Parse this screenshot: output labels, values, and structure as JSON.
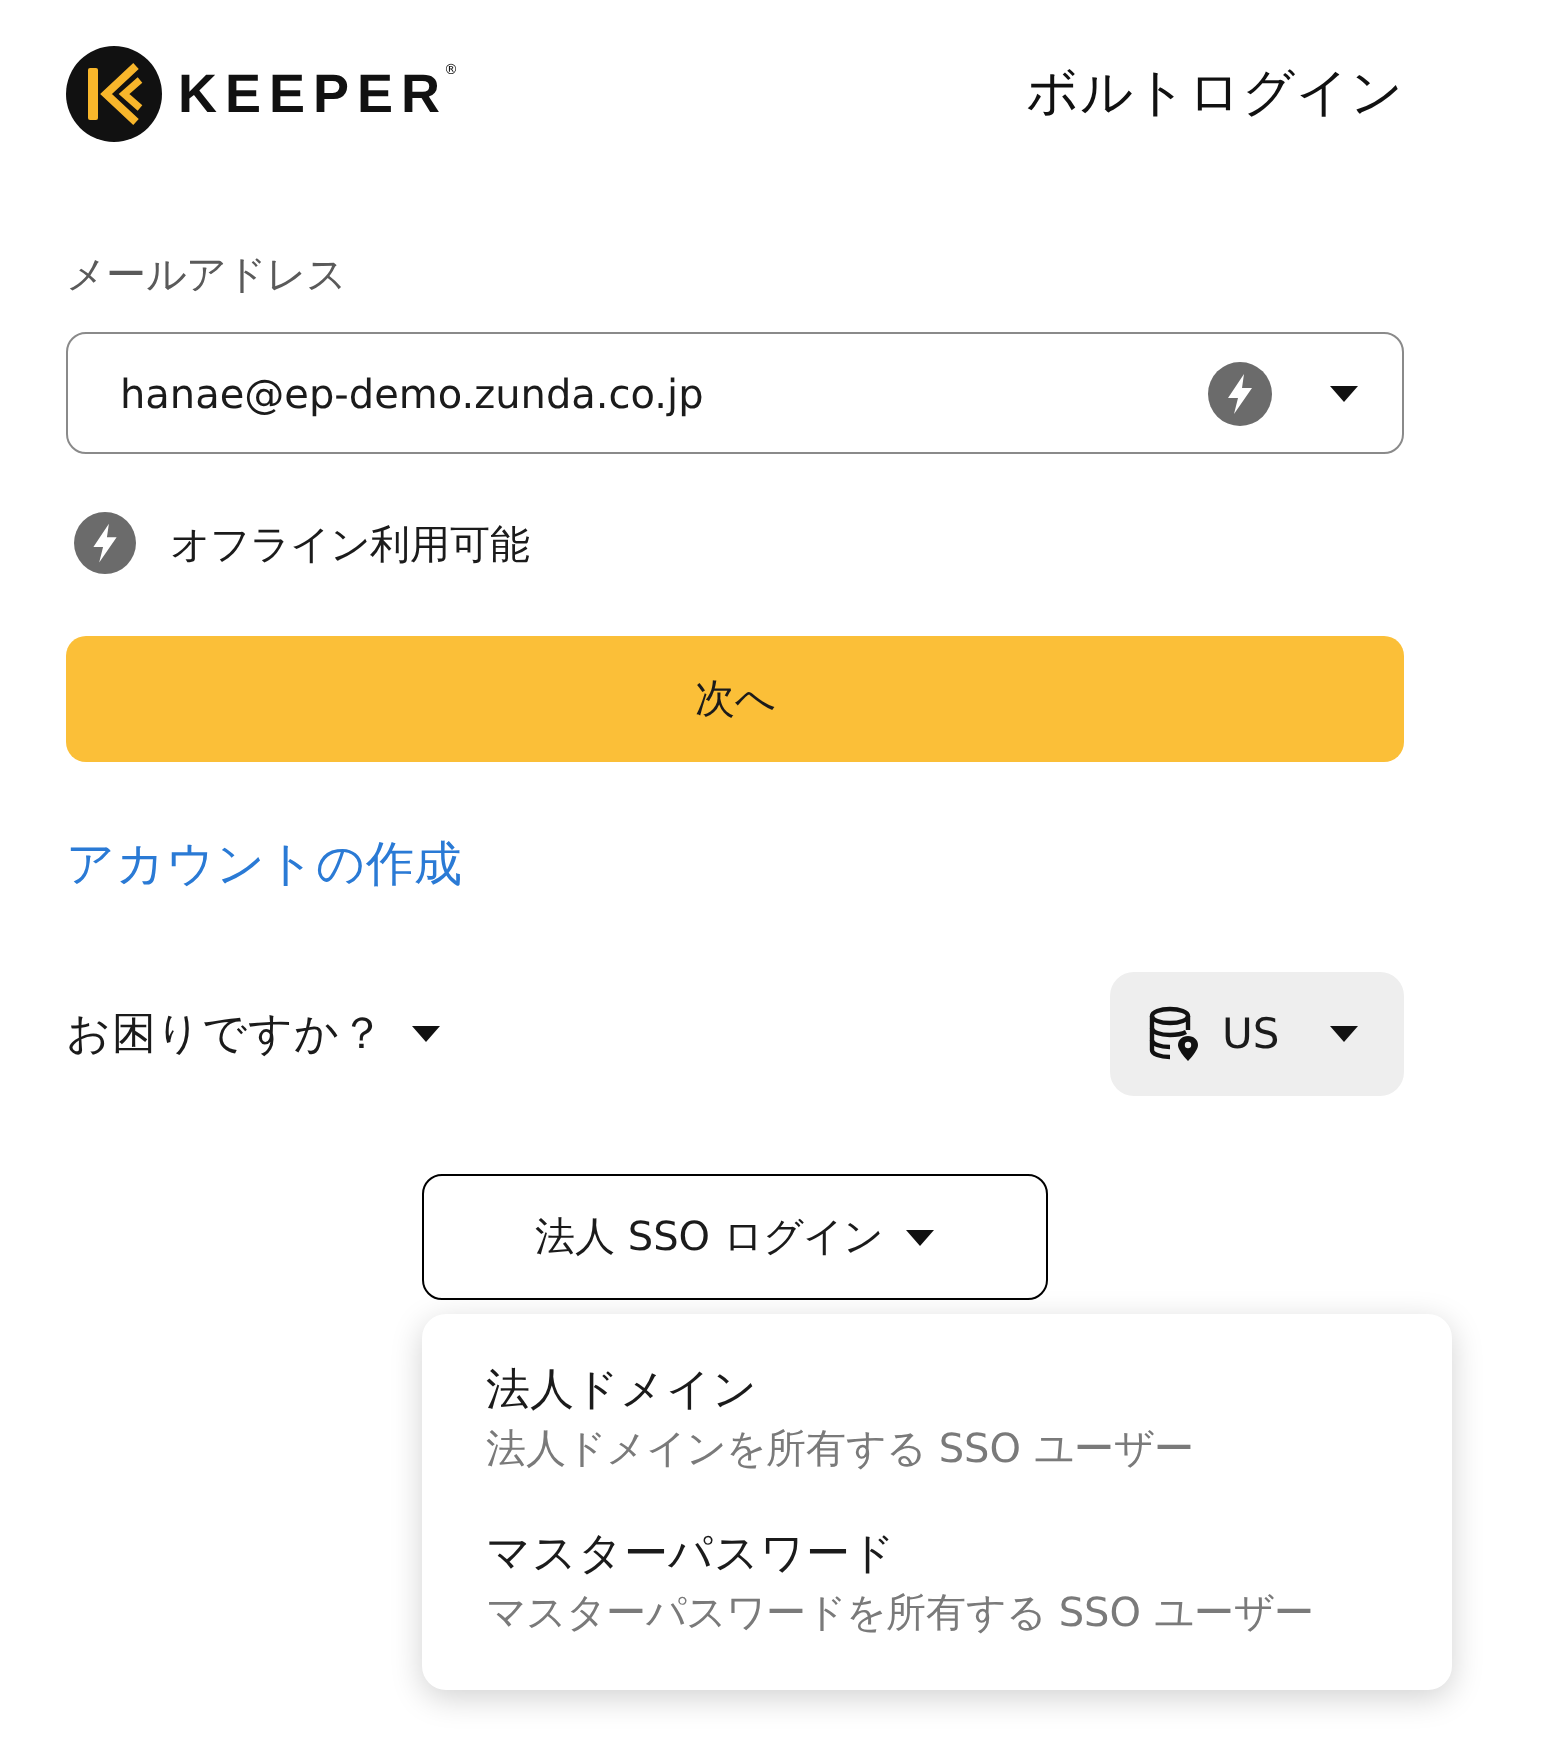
{
  "header": {
    "logo": {
      "wordmark": "KEEPER",
      "trademark": "®"
    },
    "title": "ボルトログイン"
  },
  "email": {
    "label": "メールアドレス",
    "value": "hanae@ep-demo.zunda.co.jp"
  },
  "offline_note": "オフライン利用可能",
  "next_button": "次へ",
  "create_account_link": "アカウントの作成",
  "help": {
    "label": "お困りですか？"
  },
  "region": {
    "label": "US"
  },
  "sso_button": {
    "label": "法人 SSO ログイン",
    "expanded": true
  },
  "sso_menu": {
    "items": [
      {
        "title": "法人ドメイン",
        "subtitle": "法人ドメインを所有する SSO ユーザー"
      },
      {
        "title": "マスターパスワード",
        "subtitle": "マスターパスワードを所有する SSO ユーザー"
      }
    ]
  }
}
